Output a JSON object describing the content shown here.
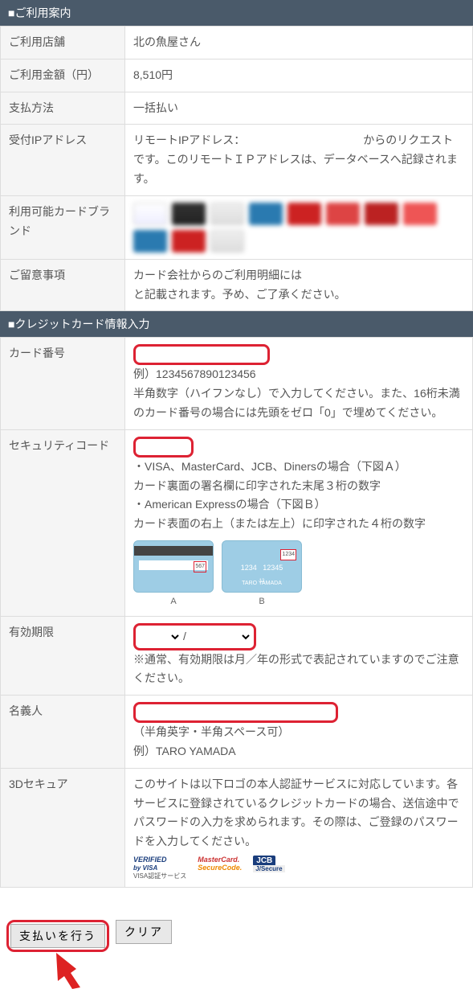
{
  "sections": {
    "usage_guide_title": "■ご利用案内",
    "cc_input_title": "■クレジットカード情報入力"
  },
  "usage": {
    "store_label": "ご利用店舗",
    "store_value": "北の魚屋さん",
    "amount_label": "ご利用金額（円）",
    "amount_value": "8,510円",
    "payment_method_label": "支払方法",
    "payment_method_value": "一括払い",
    "ip_label": "受付IPアドレス",
    "ip_value": "リモートIPアドレス：　　　　　　　　　　　からのリクエストです。このリモートＩＰアドレスは、データベースへ記録されます。",
    "brands_label": "利用可能カードブランド",
    "notice_label": "ご留意事項",
    "notice_value": "カード会社からのご利用明細には\nと記載されます。予め、ご了承ください。"
  },
  "cc": {
    "cardnum_label": "カード番号",
    "cardnum_example": "例）1234567890123456",
    "cardnum_help": "半角数字（ハイフンなし）で入力してください。また、16桁未満のカード番号の場合には先頭をゼロ「0」で埋めてください。",
    "cvv_label": "セキュリティコード",
    "cvv_help1": "・VISA、MasterCard、JCB、Dinersの場合（下図Ａ）",
    "cvv_help2": "カード裏面の署名欄に印字された末尾３桁の数字",
    "cvv_help3": "・American Expressの場合（下図Ｂ）",
    "cvv_help4": "カード表面の右上（または左上）に印字された４桁の数字",
    "cvv_card_a_label": "A",
    "cvv_card_b_label": "B",
    "cvv_sample3": "567",
    "cvv_sample4": "1234",
    "cvv_front_num1": "1234",
    "cvv_front_num2": "12345",
    "cvv_front_sub": "12",
    "cvv_front_name": "TARO YAMADA",
    "exp_label": "有効期限",
    "exp_slash": "/",
    "exp_help": "※通常、有効期限は月／年の形式で表記されていますのでご注意ください。",
    "name_label": "名義人",
    "name_help": "（半角英字・半角スペース可）",
    "name_example": "例）TARO YAMADA",
    "secure_label": "3Dセキュア",
    "secure_help": "このサイトは以下ロゴの本人認証サービスに対応しています。各サービスに登録されているクレジットカードの場合、送信途中でパスワードの入力を求められます。その際は、ご登録のパスワードを入力してください。",
    "logo_vbv1": "VERIFIED",
    "logo_vbv2": "by VISA",
    "logo_vbv3": "VISA認証サービス",
    "logo_msc1": "MasterCard.",
    "logo_msc2": "SecureCode.",
    "logo_jcb1": "JCB",
    "logo_jcb2": "J/Secure"
  },
  "buttons": {
    "submit": "支払いを行う",
    "clear": "クリア"
  }
}
